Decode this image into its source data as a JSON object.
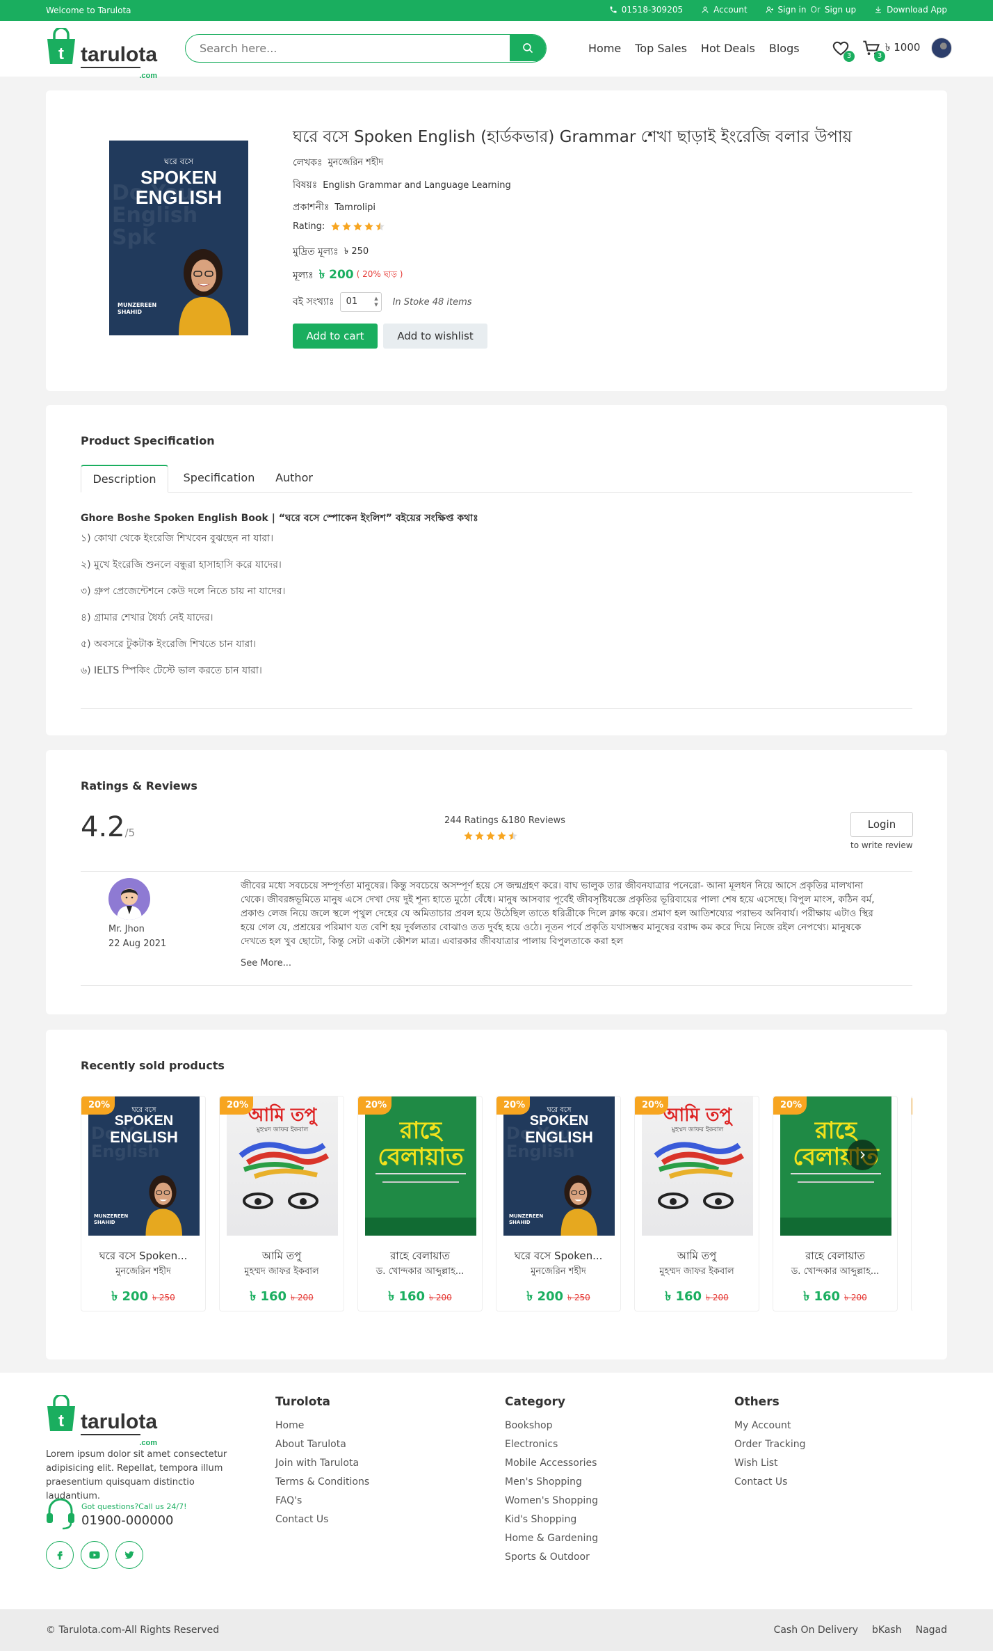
{
  "topbar": {
    "welcome": "Welcome to Tarulota",
    "phone": "01518-309205",
    "account": "Account",
    "signin": "Sign in",
    "or": "Or",
    "signup": "Sign up",
    "download": "Download App"
  },
  "header": {
    "logo_text": "tarulota",
    "logo_sub": ".com",
    "search_placeholder": "Search here...",
    "nav": [
      "Home",
      "Top Sales",
      "Hot Deals",
      "Blogs"
    ],
    "wishlist_count": "3",
    "cart_count": "3",
    "cart_amount": "৳ 1000"
  },
  "product": {
    "title": "ঘরে বসে Spoken English (হার্ডকভার) Grammar শেখা ছাড়াই ইংরেজি বলার উপায়",
    "author_label": "লেখকঃ",
    "author": "মুনজেরিন শহীদ",
    "subject_label": "বিষয়ঃ",
    "subject": "English Grammar and Language Learning",
    "publisher_label": "প্রকাশনীঃ",
    "publisher": "Tamrolipi",
    "rating_label": "Rating:",
    "rating": 4.5,
    "printed_price_label": "মুদ্রিত মূল্যঃ",
    "printed_price": "৳ 250",
    "price_label": "মূল্যঃ",
    "price": "৳ 200",
    "discount": "( 20% ছাড় )",
    "qty_label": "বই সংখ্যাঃ",
    "qty": "01",
    "stock": "In Stoke 48 items",
    "add_to_cart": "Add to cart",
    "add_to_wishlist": "Add to wishlist",
    "cover": {
      "top": "ঘরে বসে",
      "line1": "SPOKEN",
      "line2": "ENGLISH",
      "author1": "MUNZEREEN",
      "author2": "SHAHID"
    }
  },
  "spec": {
    "title": "Product Specification",
    "tabs": [
      "Description",
      "Specification",
      "Author"
    ],
    "desc_heading": "Ghore Boshe Spoken English Book | “ঘরে বসে স্পোকেন ইংলিশ” বইয়ের সংক্ষিপ্ত কথাঃ",
    "lines": [
      "১) কোথা থেকে ইংরেজি শিখবেন বুঝছেন না যারা।",
      "২) মুখে ইংরেজি শুনলে বন্ধুরা হাসাহাসি করে যাদের।",
      "৩) গ্রুপ প্রেজেন্টেশনে কেউ দলে নিতে চায় না যাদের।",
      "৪) গ্রামার শেখার ধৈর্য্য নেই যাদের।",
      "৫) অবসরে টুকটাক ইংরেজি শিখতে চান যারা।",
      "৬) IELTS স্পিকিং টেস্টে ভাল করতে চান যারা।"
    ]
  },
  "reviews": {
    "title": "Ratings & Reviews",
    "score": "4.2",
    "out_of": "/5",
    "summary": "244 Ratings &180 Reviews",
    "rating": 4.5,
    "login": "Login",
    "login_sub": "to write review",
    "items": [
      {
        "name": "Mr. Jhon",
        "date": "22 Aug 2021",
        "text": "জীবের মধ্যে সবচেয়ে সম্পূর্ণতা মানুষের। কিন্তু সবচেয়ে অসম্পূর্ণ হয়ে সে জন্মগ্রহণ করে। বাঘ ভালুক তার জীবনযাত্রার পনেরো- আনা মূলধন নিয়ে আসে প্রকৃতির মালখানা থেকে। জীবরঙ্গভূমিতে মানুষ এসে দেখা দেয় দুই শূন্য হাতে মুঠো বেঁধে। মানুষ আসবার পূর্বেই জীবসৃষ্টিযজ্ঞে প্রকৃতির ভূরিব্যয়ের পালা শেষ হয়ে এসেছে। বিপুল মাংস, কঠিন বর্ম, প্রকাণ্ড লেজ নিয়ে জলে স্থলে পৃথুল দেহের যে অমিতাচার প্রবল হয়ে উঠেছিল তাতে ধরিত্রীকে দিলে ক্লান্ত করে। প্রমাণ হল আতিশয্যের পরাভব অনিবার্য। পরীক্ষায় এটাও স্থির হয়ে গেল যে, প্রশ্রয়ের পরিমাণ যত বেশি হয় দুর্বলতার বোঝাও তত দুর্বহ হয়ে ওঠে। নূতন পর্বে প্রকৃতি যথাসম্ভব মানুষের বরাদ্দ কম করে দিয়ে নিজে রইল নেপথ্যে। মানুষকে দেখতে হল খুব ছোটো, কিন্তু সেটা একটা কৌশল মাত্র। এবারকার জীবযাত্রার পালায় বিপুলতাকে করা হল",
        "see_more": "See More..."
      }
    ]
  },
  "recent": {
    "title": "Recently sold products",
    "products": [
      {
        "badge": "20%",
        "title": "ঘরে বসে Spoken...",
        "author": "মুনজেরিন শহীদ",
        "price": "৳ 200",
        "old_price": "৳ 250",
        "art": "spoken"
      },
      {
        "badge": "20%",
        "title": "আমি তপু",
        "author": "মুহম্মদ জাফর ইকবাল",
        "price": "৳ 160",
        "old_price": "৳ 200",
        "art": "tapu"
      },
      {
        "badge": "20%",
        "title": "রাহে বেলায়াত",
        "author": "ড. খোন্দকার আব্দুল্লাহ...",
        "price": "৳ 160",
        "old_price": "৳ 200",
        "art": "rahe"
      },
      {
        "badge": "20%",
        "title": "ঘরে বসে Spoken...",
        "author": "মুনজেরিন শহীদ",
        "price": "৳ 200",
        "old_price": "৳ 250",
        "art": "spoken"
      },
      {
        "badge": "20%",
        "title": "আমি তপু",
        "author": "মুহম্মদ জাফর ইকবাল",
        "price": "৳ 160",
        "old_price": "৳ 200",
        "art": "tapu"
      },
      {
        "badge": "20%",
        "title": "রাহে বেলায়াত",
        "author": "ড. খোন্দকার আব্দুল্লাহ...",
        "price": "৳ 160",
        "old_price": "৳ 200",
        "art": "rahe"
      }
    ],
    "art_text": {
      "tapu_title": "আমি তপু",
      "tapu_author": "মুহম্মদ জাফর ইকবাল",
      "rahe_title": "রাহে বেলায়াত"
    }
  },
  "footer": {
    "about": "Lorem ipsum dolor sit amet consectetur adipisicing elit. Repellat, tempora illum praesentium quisquam distinctio laudantium.",
    "phone_q": "Got questions?Call us 24/7!",
    "phone": "01900-000000",
    "col1": {
      "title": "Turolota",
      "links": [
        "Home",
        "About Tarulota",
        "Join with Tarulota",
        "Terms & Conditions",
        "FAQ's",
        "Contact Us"
      ]
    },
    "col2": {
      "title": "Category",
      "links": [
        "Bookshop",
        "Electronics",
        "Mobile Accessories",
        "Men's Shopping",
        "Women's Shopping",
        "Kid's Shopping",
        "Home & Gardening",
        "Sports & Outdoor"
      ]
    },
    "col3": {
      "title": "Others",
      "links": [
        "My Account",
        "Order Tracking",
        "Wish List",
        "Contact Us"
      ]
    },
    "copyright": "© Tarulota.com-All Rights Reserved",
    "payments": [
      "Cash On Delivery",
      "bKash",
      "Nagad"
    ]
  },
  "colors": {
    "brand": "#1aae5f",
    "star": "#f7a520",
    "discount": "#e53935"
  }
}
